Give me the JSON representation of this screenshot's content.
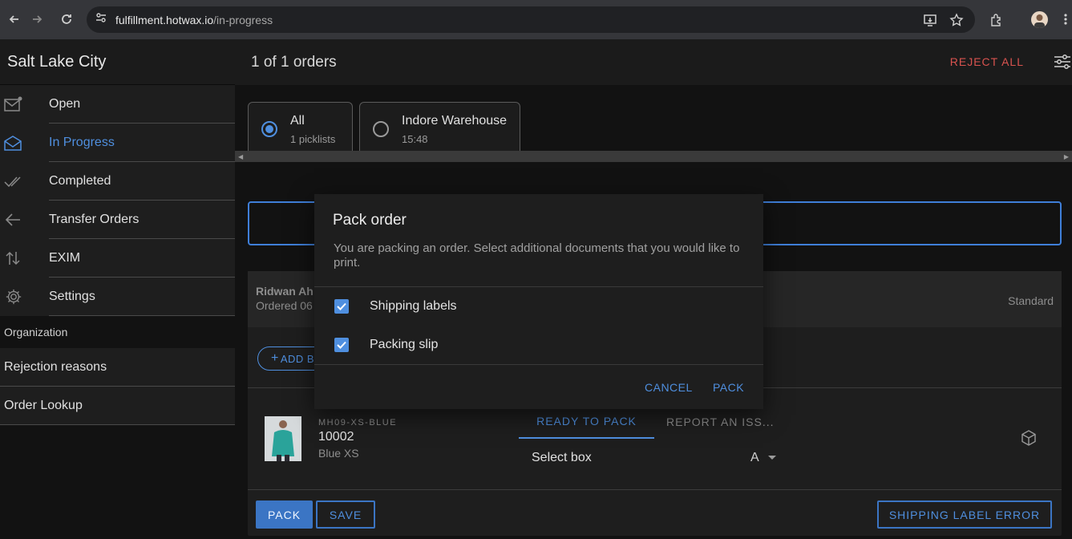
{
  "browser": {
    "url_host": "fulfillment.hotwax.io",
    "url_path": "/in-progress"
  },
  "sidebar": {
    "facility": "Salt Lake City",
    "items": [
      {
        "label": "Open",
        "icon": "mail-unread-icon"
      },
      {
        "label": "In Progress",
        "icon": "mail-open-icon"
      },
      {
        "label": "Completed",
        "icon": "checkmark-done-icon"
      },
      {
        "label": "Transfer Orders",
        "icon": "arrow-back-icon"
      },
      {
        "label": "EXIM",
        "icon": "swap-vertical-icon"
      },
      {
        "label": "Settings",
        "icon": "settings-icon"
      }
    ],
    "section_label": "Organization",
    "org_items": [
      {
        "label": "Rejection reasons"
      },
      {
        "label": "Order Lookup"
      }
    ]
  },
  "main": {
    "title": "1 of 1 orders",
    "reject_all": "REJECT ALL",
    "picklists": [
      {
        "title": "All",
        "subtitle": "1 picklists",
        "selected": true
      },
      {
        "title": "Indore Warehouse",
        "subtitle": "15:48",
        "selected": false
      }
    ]
  },
  "order": {
    "customer": "Ridwan Ah",
    "date": "Ordered 06",
    "shipping_method": "Standard",
    "add_box": "ADD B",
    "item": {
      "sku": "MH09-XS-BLUE",
      "id": "10002",
      "variant": "Blue XS"
    },
    "tabs": {
      "ready": "READY TO PACK",
      "report": "REPORT AN ISS..."
    },
    "select_box_label": "Select box",
    "select_box_value": "A",
    "buttons": {
      "pack": "PACK",
      "save": "SAVE",
      "shipping_error": "SHIPPING LABEL ERROR"
    }
  },
  "modal": {
    "title": "Pack order",
    "message": "You are packing an order. Select additional documents that you would like to print.",
    "options": [
      {
        "label": "Shipping labels",
        "checked": true
      },
      {
        "label": "Packing slip",
        "checked": true
      }
    ],
    "cancel": "CANCEL",
    "pack": "PACK"
  },
  "colors": {
    "accent": "#4f8fdf",
    "danger": "#d9534f",
    "background": "#121212"
  }
}
